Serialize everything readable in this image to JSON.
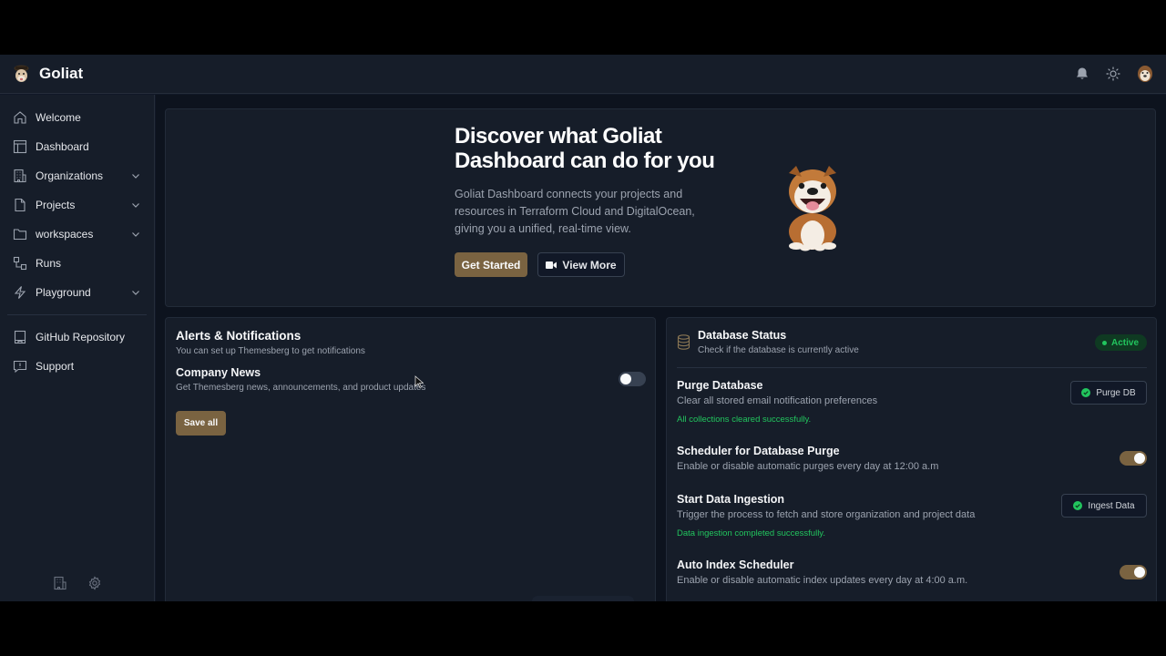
{
  "app": {
    "name": "Goliat",
    "logo_icon": "bulldog-pirate-logo",
    "topbar_icons": [
      "bell-icon",
      "sun-icon",
      "user-avatar"
    ]
  },
  "sidebar": {
    "items": [
      {
        "label": "Welcome",
        "icon": "home-icon",
        "has_chevron": false
      },
      {
        "label": "Dashboard",
        "icon": "table-layout-icon",
        "has_chevron": false
      },
      {
        "label": "Organizations",
        "icon": "building-icon",
        "has_chevron": true
      },
      {
        "label": "Projects",
        "icon": "file-icon",
        "has_chevron": true
      },
      {
        "label": "workspaces",
        "icon": "folder-icon",
        "has_chevron": true
      },
      {
        "label": "Runs",
        "icon": "workflow-icon",
        "has_chevron": false
      },
      {
        "label": "Playground",
        "icon": "zap-icon",
        "has_chevron": true
      }
    ],
    "secondary_items": [
      {
        "label": "GitHub Repository",
        "icon": "book-icon"
      },
      {
        "label": "Support",
        "icon": "message-alert-icon"
      }
    ],
    "bottom_icons": [
      "building-icon",
      "gear-icon"
    ]
  },
  "hero": {
    "title": "Discover what Goliat Dashboard can do for you",
    "description": "Goliat Dashboard connects your projects and resources in Terraform Cloud and DigitalOcean, giving you a unified, real-time view.",
    "get_started_label": "Get Started",
    "view_more_label": "View More",
    "view_more_icon": "video-icon",
    "image": "bulldog-mascot"
  },
  "alerts": {
    "title": "Alerts & Notifications",
    "subtitle": "You can set up Themesberg to get notifications",
    "company_news": {
      "title": "Company News",
      "subtitle": "Get Themesberg news, announcements, and product updates",
      "enabled": false
    },
    "save_label": "Save all"
  },
  "database": {
    "title": "Database Status",
    "subtitle": "Check if the database is currently active",
    "status": "Active",
    "status_color": "#22c55e",
    "purge": {
      "title": "Purge Database",
      "subtitle": "Clear all stored email notification preferences",
      "message": "All collections cleared successfully.",
      "button_label": "Purge DB"
    },
    "scheduler": {
      "title": "Scheduler for Database Purge",
      "subtitle": "Enable or disable automatic purges every day at 12:00 a.m",
      "enabled": true
    },
    "ingestion": {
      "title": "Start Data Ingestion",
      "subtitle": "Trigger the process to fetch and store organization and project data",
      "message": "Data ingestion completed successfully.",
      "button_label": "Ingest Data"
    },
    "auto_index": {
      "title": "Auto Index Scheduler",
      "subtitle": "Enable or disable automatic index updates every day at 4:00 a.m.",
      "enabled": true
    }
  },
  "colors": {
    "accent": "#7a6341",
    "success": "#22c55e",
    "background": "#111827",
    "surface": "#161d29"
  }
}
